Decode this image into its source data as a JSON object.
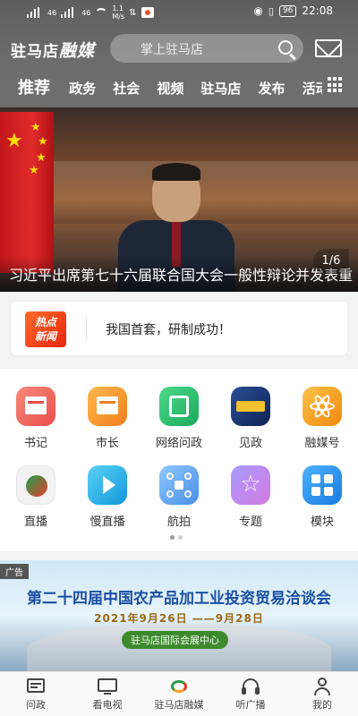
{
  "status_bar": {
    "signal_left": "46",
    "signal_right": "46",
    "speed": "1.1\nM/s",
    "battery": "96",
    "time": "22:08"
  },
  "header": {
    "logo_main": "驻马店",
    "logo_script": "融媒",
    "search_placeholder": "掌上驻马店"
  },
  "tabs": [
    "推荐",
    "政务",
    "社会",
    "视频",
    "驻马店",
    "发布",
    "活动"
  ],
  "hero": {
    "caption": "习近平出席第七十六届联合国大会一般性辩论并发表重要讲话",
    "pager": "1/6"
  },
  "hot_news": {
    "badge_line1": "热点",
    "badge_line2": "新闻",
    "headline": "我国首套，研制成功！"
  },
  "grid": {
    "items": [
      {
        "label": "书记",
        "icon": "secretary-folder-icon",
        "color": "#f06b6b"
      },
      {
        "label": "市长",
        "icon": "mayor-folder-icon",
        "color": "#f39a33"
      },
      {
        "label": "网络问政",
        "icon": "online-inquiry-icon",
        "color": "#2cc16e"
      },
      {
        "label": "见政",
        "icon": "jianzheng-icon",
        "color": "#1d3b7a"
      },
      {
        "label": "融媒号",
        "icon": "atom-icon",
        "color": "#f6a623"
      },
      {
        "label": "直播",
        "icon": "live-icon",
        "color": "#f2f2f2"
      },
      {
        "label": "慢直播",
        "icon": "slow-live-icon",
        "color": "#26b3e8"
      },
      {
        "label": "航拍",
        "icon": "drone-icon",
        "color": "#5aa8f0"
      },
      {
        "label": "专题",
        "icon": "star-icon",
        "color": "#7b72e8"
      },
      {
        "label": "模块",
        "icon": "modules-icon",
        "color": "#2b95f0"
      }
    ]
  },
  "ad": {
    "tag": "广告",
    "title": "第二十四届中国农产品加工业投资贸易洽谈会",
    "dates": "2021年9月26日 ——9月28日",
    "venue": "驻马店国际会展中心"
  },
  "bottom_nav": [
    {
      "label": "问政",
      "icon": "inquiry-icon"
    },
    {
      "label": "看电视",
      "icon": "tv-icon"
    },
    {
      "label": "驻马店融媒",
      "icon": "app-logo-icon"
    },
    {
      "label": "听广播",
      "icon": "headphones-icon"
    },
    {
      "label": "我的",
      "icon": "user-icon"
    }
  ]
}
